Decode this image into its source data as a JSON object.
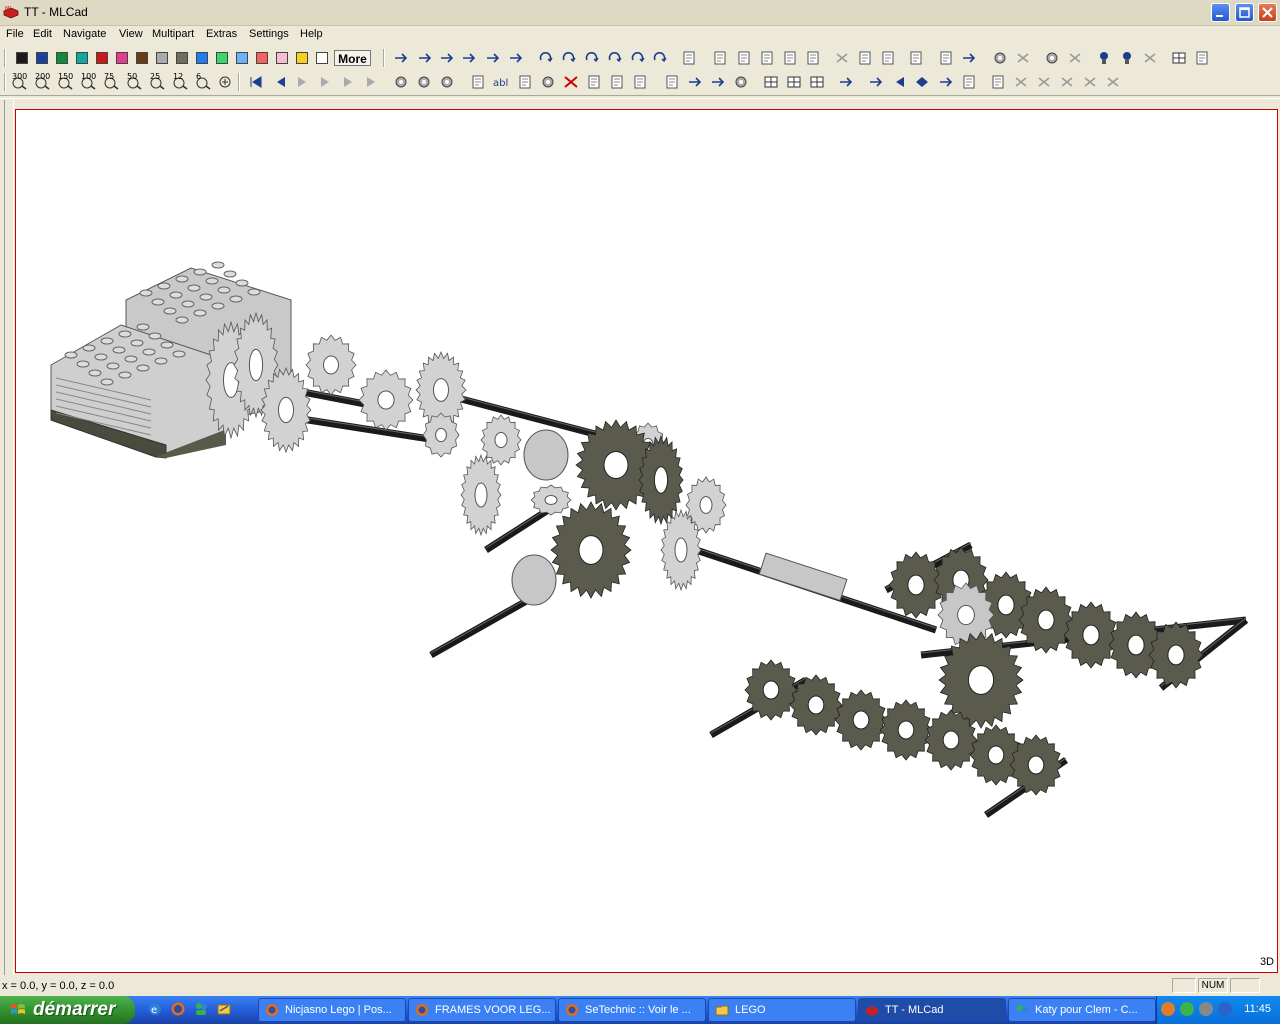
{
  "window": {
    "title": "TT - MLCad"
  },
  "menu": [
    "File",
    "Edit",
    "Navigate",
    "View",
    "Multipart",
    "Extras",
    "Settings",
    "Help"
  ],
  "palette": {
    "colors": [
      "#1a1a1a",
      "#1c3f9c",
      "#118a3b",
      "#10a7a0",
      "#c91a1a",
      "#e33d8f",
      "#6b3a13",
      "#a9a9a9",
      "#6d6e5c",
      "#1e7df0",
      "#3ad86b",
      "#6fb1f6",
      "#f2645f",
      "#f7bdd0",
      "#f7d11c",
      "#ffffff"
    ],
    "more_label": "More"
  },
  "zoom_levels": [
    "300",
    "200",
    "150",
    "100",
    "75",
    "50",
    "25",
    "12",
    "6"
  ],
  "viewport": {
    "label": "3D"
  },
  "status": {
    "coords": "x = 0.0, y = 0.0, z = 0.0",
    "num": "NUM"
  },
  "taskbar": {
    "start_label": "démarrer",
    "tasks": [
      {
        "label": "Nicjasno Lego | Pos...",
        "icon": "firefox-icon"
      },
      {
        "label": "FRAMES VOOR LEG...",
        "icon": "firefox-icon"
      },
      {
        "label": "SeTechnic :: Voir le ...",
        "icon": "firefox-icon"
      },
      {
        "label": "LEGO",
        "icon": "folder-icon"
      },
      {
        "label": "TT - MLCad",
        "icon": "mlcad-icon"
      },
      {
        "label": "Katy pour Clem - C...",
        "icon": "messenger-icon"
      }
    ],
    "clock": "11:45"
  }
}
